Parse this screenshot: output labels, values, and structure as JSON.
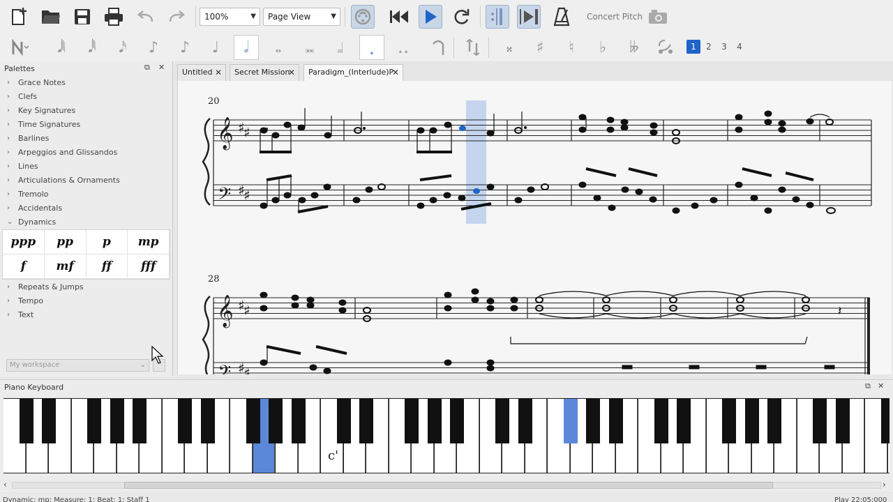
{
  "toolbar": {
    "zoom": "100%",
    "view_mode": "Page View",
    "concert_pitch": "Concert Pitch"
  },
  "note_input": {
    "voices": [
      "1",
      "2",
      "3",
      "4"
    ]
  },
  "palettes": {
    "title": "Palettes",
    "items": [
      "Grace Notes",
      "Clefs",
      "Key Signatures",
      "Time Signatures",
      "Barlines",
      "Arpeggios and Glissandos",
      "Lines",
      "Articulations & Ornaments",
      "Tremolo",
      "Accidentals",
      "Dynamics"
    ],
    "dynamics": [
      "ppp",
      "pp",
      "p",
      "mp",
      "f",
      "mf",
      "ff",
      "fff"
    ],
    "items_after": [
      "Repeats & Jumps",
      "Tempo",
      "Text"
    ],
    "workspace": "My workspace"
  },
  "tabs": [
    "Untitled",
    "Secret Mission",
    "Paradigm_(Interlude)P"
  ],
  "score": {
    "measure_numbers": [
      "20",
      "28"
    ]
  },
  "piano": {
    "title": "Piano Keyboard",
    "c_label": "c'"
  },
  "status": {
    "left": "Dynamic: mp;  Measure: 1; Beat: 1; Staff 1",
    "right": "Play    22:05:000"
  },
  "colors": {
    "selection": "#c5d5ee",
    "highlight_key": "#5b88d8",
    "voice1": "#1f64c8"
  }
}
